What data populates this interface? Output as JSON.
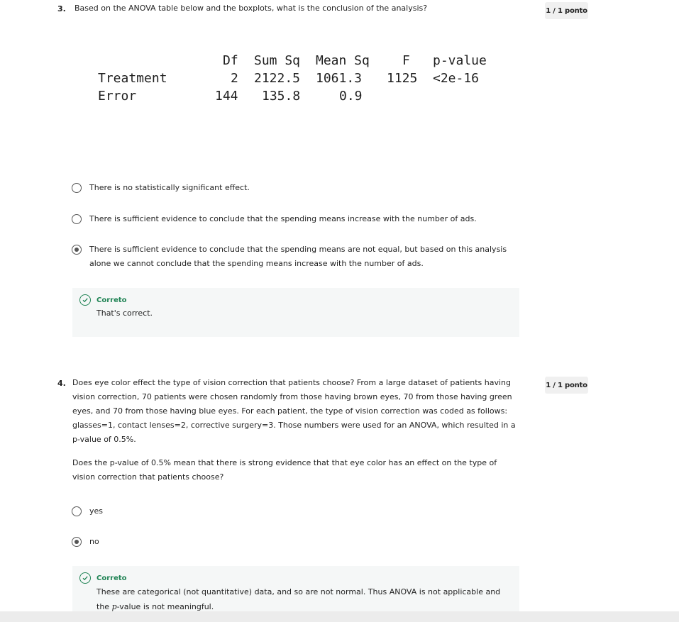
{
  "q3": {
    "number": "3.",
    "text": "Based on the ANOVA table below and the boxplots, what is the conclusion of the analysis?",
    "score": "1 / 1 ponto",
    "anova_table": {
      "headers": [
        "Df",
        "Sum Sq",
        "Mean Sq",
        "F",
        "p-value"
      ],
      "rows": [
        {
          "label": "Treatment",
          "df": "2",
          "sum_sq": "2122.5",
          "mean_sq": "1061.3",
          "f": "1125",
          "p": "<2e-16"
        },
        {
          "label": "Error",
          "df": "144",
          "sum_sq": "135.8",
          "mean_sq": "0.9",
          "f": "",
          "p": ""
        }
      ]
    },
    "options": [
      {
        "label": "There is no statistically significant effect.",
        "selected": false
      },
      {
        "label": "There is sufficient evidence to conclude that the spending means increase with the number of ads.",
        "selected": false
      },
      {
        "label": "There is sufficient evidence to conclude that the spending means are not equal, but based on this analysis alone we cannot conclude that the spending means increase with the number of ads.",
        "selected": true
      }
    ],
    "feedback": {
      "title": "Correto",
      "text": "That's correct."
    }
  },
  "q4": {
    "number": "4.",
    "text": "Does eye color effect the type of vision correction that patients choose? From a large dataset of patients having vision correction, 70 patients were chosen randomly from those having brown eyes, 70 from those having green eyes, and 70 from those having blue eyes. For each patient, the type of vision correction was coded as follows: glasses=1, contact lenses=2, corrective surgery=3. Those numbers were used for an ANOVA, which resulted in a p-value of 0.5%.",
    "question": "Does the p-value of 0.5% mean that there is strong evidence that that eye color has an effect on the type of vision correction that patients choose?",
    "score": "1 / 1 ponto",
    "options": [
      {
        "label": "yes",
        "selected": false
      },
      {
        "label": "no",
        "selected": true
      }
    ],
    "feedback": {
      "title": "Correto",
      "text_before": "These are categorical (not quantitative) data, and so are not normal. Thus ANOVA is not applicable and the",
      "p_symbol": "p",
      "text_after": "-value is not meaningful."
    }
  },
  "icons": {
    "radio": "radio-button-icon",
    "check": "check-circle-icon"
  },
  "colors": {
    "correct": "#1f8354",
    "feedback_bg": "#f5f7f7",
    "score_bg": "#f0f0f0"
  }
}
